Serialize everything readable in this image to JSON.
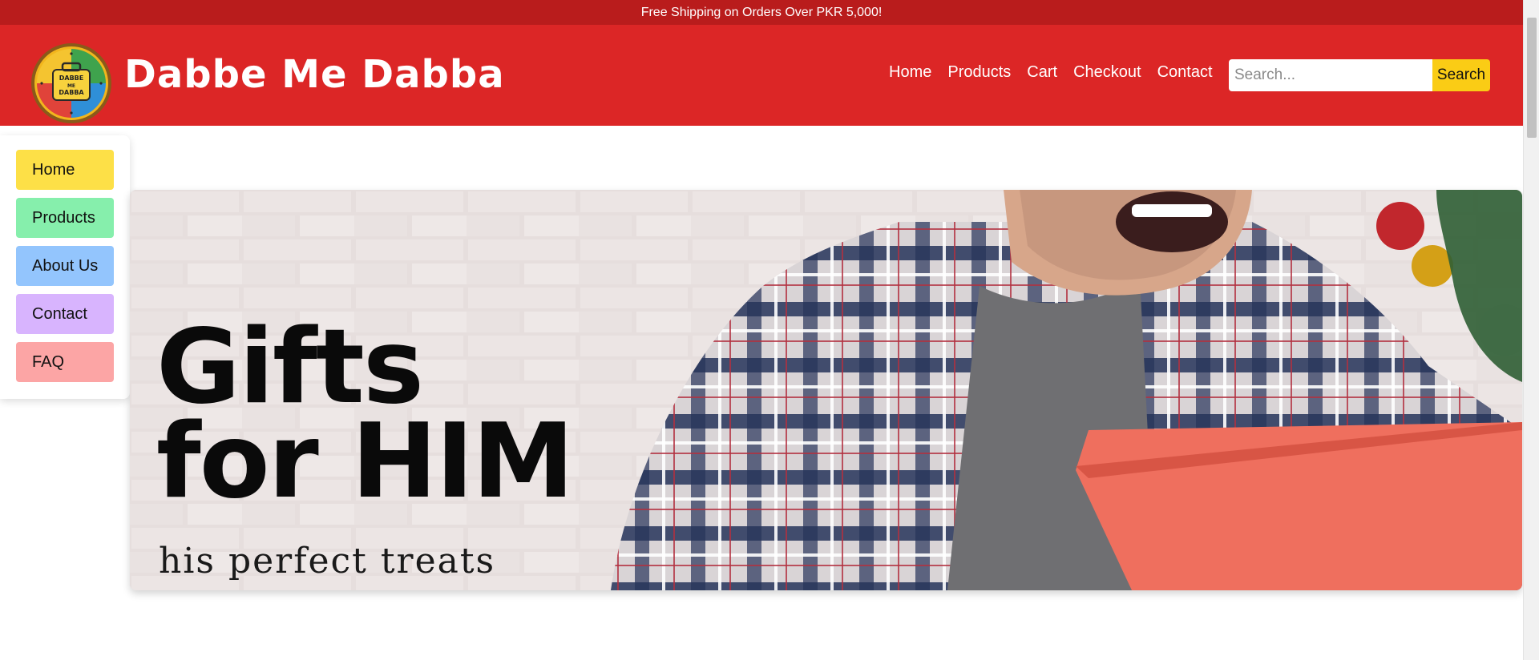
{
  "announcement": {
    "text": "Free Shipping on Orders Over PKR 5,000!"
  },
  "header": {
    "logo_text_lines": [
      "DABBE",
      "ME",
      "DABBA"
    ],
    "brand_name": "Dabbe Me Dabba",
    "nav": [
      "Home",
      "Products",
      "Cart",
      "Checkout",
      "Contact"
    ],
    "search": {
      "placeholder": "Search...",
      "value": "",
      "button_label": "Search"
    }
  },
  "sidebar": {
    "items": [
      {
        "label": "Home",
        "color": "#fde047"
      },
      {
        "label": "Products",
        "color": "#86efac"
      },
      {
        "label": "About Us",
        "color": "#93c5fd"
      },
      {
        "label": "Contact",
        "color": "#d8b4fe"
      },
      {
        "label": "FAQ",
        "color": "#fca5a5"
      }
    ]
  },
  "hero": {
    "title_line1": "Gifts",
    "title_line2": "for HIM",
    "subtitle": "his perfect treats"
  },
  "colors": {
    "announcement_bg": "#b91c1c",
    "header_bg": "#dc2626",
    "search_button_bg": "#facc15"
  }
}
